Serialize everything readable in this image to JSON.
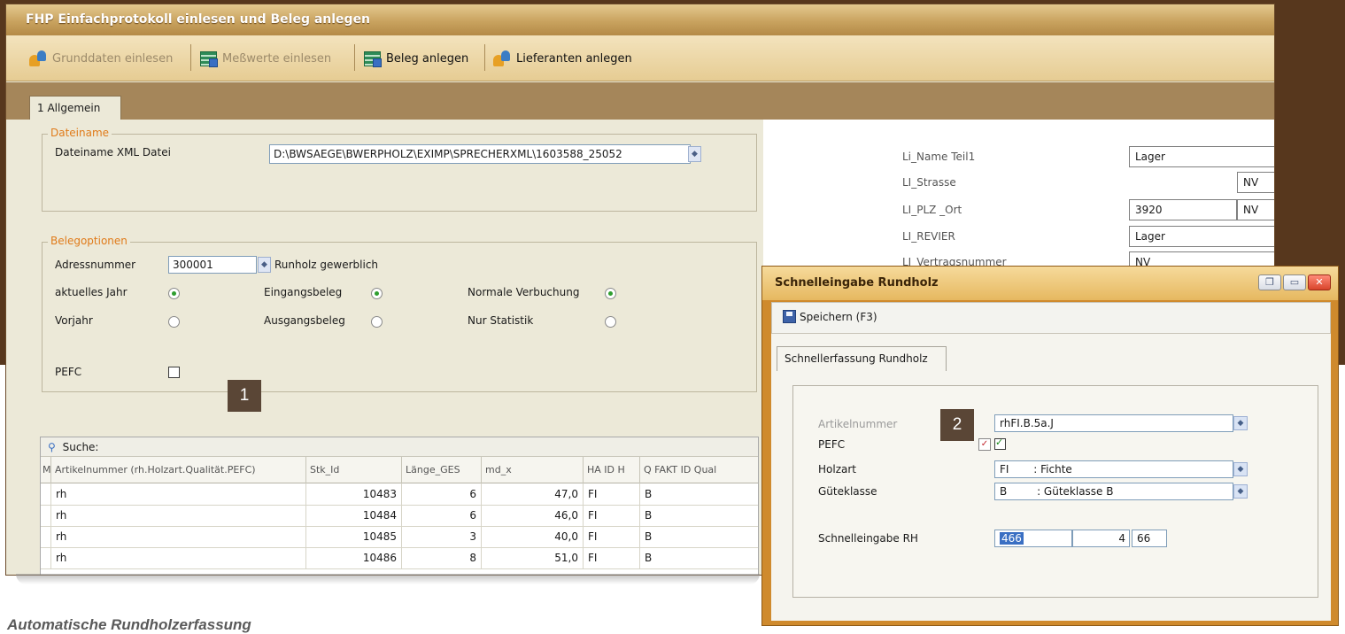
{
  "colors": {
    "backdrop": "#57371d",
    "title_bar": "#c9a35f",
    "accent_orange": "#e07b1a",
    "dialog_frame": "#cf8a2d",
    "badge": "#5a4636"
  },
  "window": {
    "title": "FHP Einfachprotokoll einlesen und Beleg anlegen"
  },
  "toolbar": {
    "buttons": [
      {
        "label": "Grunddaten einlesen",
        "icon": "people-icon",
        "enabled": false
      },
      {
        "label": "Meßwerte einlesen",
        "icon": "table-icon",
        "enabled": false
      },
      {
        "label": "Beleg anlegen",
        "icon": "table-icon",
        "enabled": true
      },
      {
        "label": "Lieferanten anlegen",
        "icon": "people-icon",
        "enabled": true
      }
    ]
  },
  "tabs": [
    {
      "label": "1 Allgemein",
      "active": true
    }
  ],
  "dateiname": {
    "legend": "Dateiname",
    "label": "Dateiname XML Datei",
    "value": "D:\\BWSAEGE\\BWERPHOLZ\\EXIMP\\SPRECHERXML\\1603588_25052"
  },
  "belegoptionen": {
    "legend": "Belegoptionen",
    "adressnummer_label": "Adressnummer",
    "adressnummer_value": "300001",
    "runholz_label": "Runholz gewerblich",
    "options": [
      {
        "label": "aktuelles Jahr",
        "checked": true
      },
      {
        "label": "Vorjahr",
        "checked": false
      },
      {
        "label": "Eingangsbeleg",
        "checked": true
      },
      {
        "label": "Ausgangsbeleg",
        "checked": false
      },
      {
        "label": "Normale Verbuchung",
        "checked": true
      },
      {
        "label": "Nur Statistik",
        "checked": false
      }
    ],
    "pefc_label": "PEFC",
    "pefc_checked": false
  },
  "badges": {
    "one": "1",
    "two": "2"
  },
  "grid": {
    "search_label": "Suche:",
    "columns": [
      "M",
      "Artikelnummer (rh.Holzart.Qualität.PEFC)",
      "Stk_Id",
      "Länge_GES",
      "md_x",
      "HA ID H",
      "Q FAKT ID Qual"
    ],
    "rows": [
      [
        "",
        "rh",
        "10483",
        "6",
        "47,0",
        "FI",
        "B"
      ],
      [
        "",
        "rh",
        "10484",
        "6",
        "46,0",
        "FI",
        "B"
      ],
      [
        "",
        "rh",
        "10485",
        "3",
        "40,0",
        "FI",
        "B"
      ],
      [
        "",
        "rh",
        "10486",
        "8",
        "51,0",
        "FI",
        "B"
      ]
    ]
  },
  "info": {
    "fields": [
      {
        "label": "Li_Name Teil1",
        "value": "Lager"
      },
      {
        "label": "LI_Strasse",
        "value": "NV"
      },
      {
        "label": "LI_PLZ _Ort",
        "value": "3920",
        "value2": "NV"
      },
      {
        "label": "LI_REVIER",
        "value": "Lager"
      },
      {
        "label": "LI_Vertragsnummer",
        "value": "NV"
      }
    ]
  },
  "dialog": {
    "title": "Schnelleingabe Rundholz",
    "save_label": "Speichern (F3)",
    "tab_label": "Schnellerfassung Rundholz",
    "artikelnummer_label": "Artikelnummer",
    "artikelnummer_value": "rhFI.B.5a.J",
    "pefc_label": "PEFC",
    "pefc_checked": true,
    "holzart_label": "Holzart",
    "holzart_code": "FI",
    "holzart_name": ": Fichte",
    "gueteklasse_label": "Güteklasse",
    "gueteklasse_code": "B",
    "gueteklasse_name": ": Güteklasse B",
    "schnelleingabe_label": "Schnelleingabe RH",
    "schnelleingabe_value": "466",
    "field_a": "4",
    "field_b": "66"
  },
  "caption": "Automatische Rundholzerfassung"
}
